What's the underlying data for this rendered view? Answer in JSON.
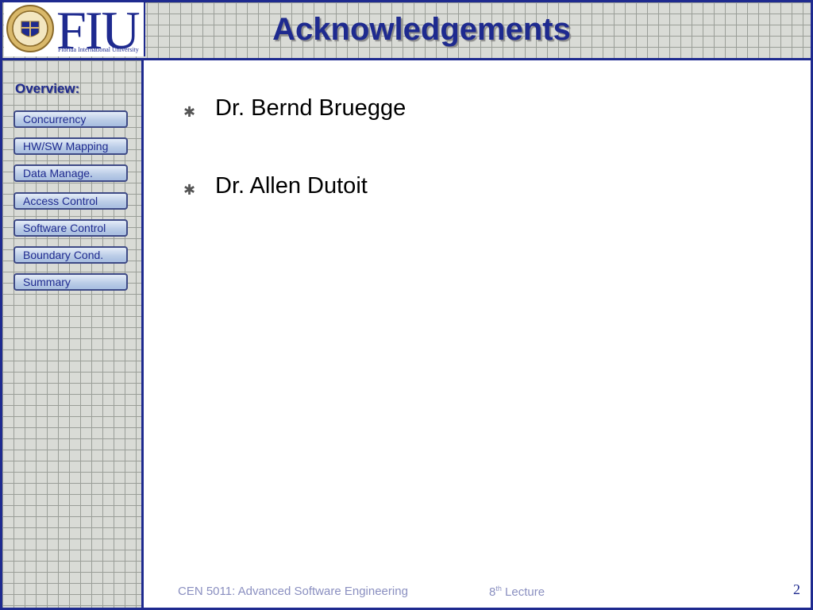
{
  "header": {
    "logo_text": "FIU",
    "logo_subtext": "Florida International University",
    "title": "Acknowledgements"
  },
  "sidebar": {
    "overview_label": "Overview:",
    "items": [
      {
        "label": "Concurrency"
      },
      {
        "label": "HW/SW Mapping"
      },
      {
        "label": "Data Manage."
      },
      {
        "label": "Access Control"
      },
      {
        "label": "Software Control"
      },
      {
        "label": "Boundary Cond."
      },
      {
        "label": "Summary"
      }
    ]
  },
  "content": {
    "bullets": [
      {
        "icon": "asterisk-bullet-icon",
        "text": "Dr. Bernd Bruegge"
      },
      {
        "icon": "asterisk-bullet-icon",
        "text": "Dr. Allen Dutoit"
      }
    ]
  },
  "footer": {
    "course": "CEN 5011: Advanced Software Engineering",
    "lecture_num": "8",
    "lecture_sup": "th",
    "lecture_label": "Lecture",
    "page_number": "2"
  },
  "colors": {
    "frame": "#1e2a8f",
    "grid_bg": "#d9dbd6",
    "nav_button": "#b9cbe6",
    "footer_text": "#8a8fc0"
  }
}
